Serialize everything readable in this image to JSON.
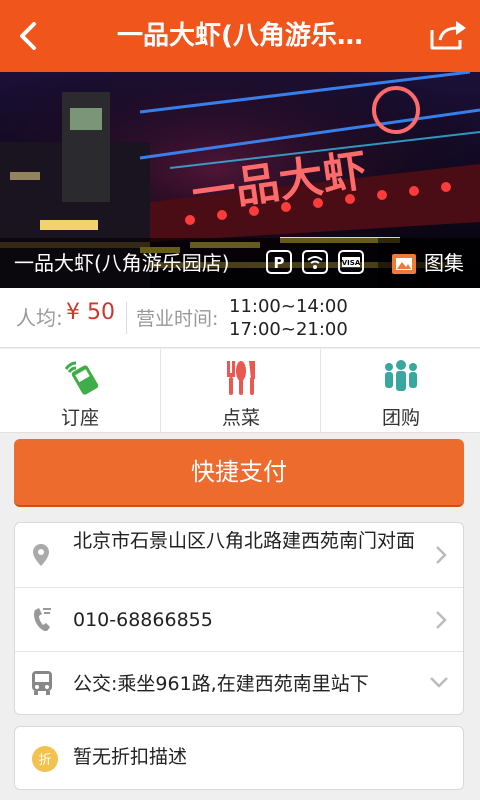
{
  "header": {
    "title": "一品大虾(八角游乐…"
  },
  "hero": {
    "store_name": "一品大虾(八角游乐园店)",
    "amenity_icons": [
      "parking-icon",
      "wifi-icon",
      "visa-card-icon"
    ],
    "sign_text": "一品大虾",
    "gallery_label": "图集"
  },
  "info": {
    "avg_label": "人均:",
    "avg_value": "¥ 50",
    "hours_label": "营业时间:",
    "hours": [
      "11:00~14:00",
      "17:00~21:00"
    ]
  },
  "features": [
    {
      "label": "订座",
      "icon": "phone-reserve-icon",
      "color": "#3fae49"
    },
    {
      "label": "点菜",
      "icon": "utensils-icon",
      "color": "#e85a4f"
    },
    {
      "label": "团购",
      "icon": "group-icon",
      "color": "#3aa6a0"
    }
  ],
  "pay_button": {
    "label": "快捷支付"
  },
  "details": {
    "address": "北京市石景山区八角北路建西苑南门对面",
    "phone": "010-68866855",
    "transit": "公交:乘坐961路,在建西苑南里站下"
  },
  "discount": {
    "badge": "折",
    "text": "暂无折扣描述"
  },
  "colors": {
    "brand": "#f0551c",
    "pay": "#ee6b2e",
    "price": "#d0362b"
  }
}
